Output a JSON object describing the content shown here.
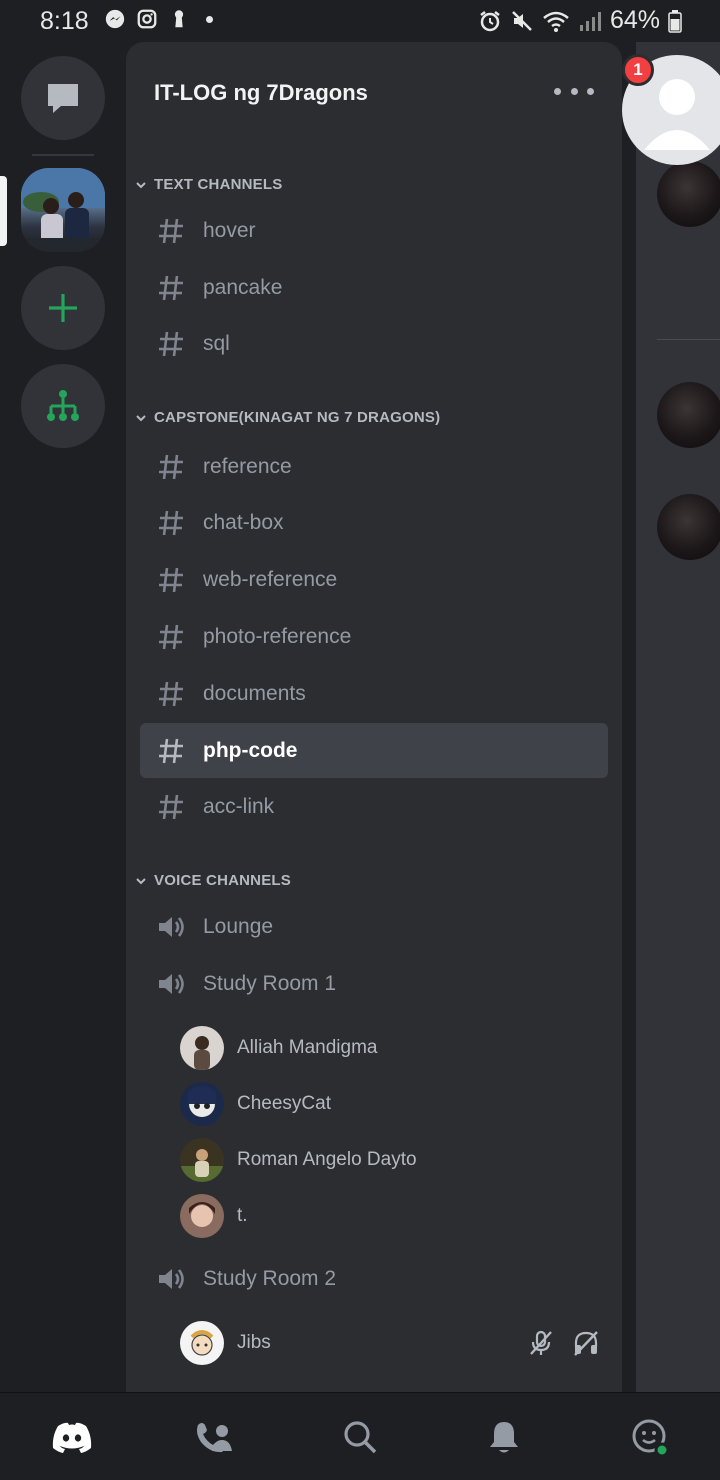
{
  "status_bar": {
    "time": "8:18",
    "battery": "64%"
  },
  "server": {
    "name": "IT-LOG ng 7Dragons"
  },
  "categories": {
    "text": "TEXT CHANNELS",
    "capstone": "CAPSTONE(KINAGAT NG 7 DRAGONS)",
    "voice": "VOICE CHANNELS"
  },
  "text_channels": [
    "hover",
    "pancake",
    "sql"
  ],
  "capstone_channels": [
    "reference",
    "chat-box",
    "web-reference",
    "photo-reference",
    "documents",
    "php-code",
    "acc-link"
  ],
  "active_channel": "php-code",
  "voice_channels": [
    "Lounge",
    "Study Room 1",
    "Study Room 2"
  ],
  "voice_users_room1": [
    "Alliah Mandigma",
    "CheesyCat",
    "Roman Angelo Dayto",
    "t."
  ],
  "voice_users_room2": [
    "Jibs"
  ],
  "notification_count": "1",
  "icons": {
    "dm": "chat-bubble-icon",
    "add_server": "plus-icon",
    "discover": "hierarchy-icon",
    "more": "more-dots-icon",
    "hash": "hash-icon",
    "speaker": "speaker-icon",
    "mute": "mic-muted-icon",
    "deafen": "headphones-muted-icon"
  },
  "bottom_nav": [
    "home-icon",
    "friends-icon",
    "search-icon",
    "bell-icon",
    "profile-icon"
  ],
  "colors": {
    "accent_green": "#23a55a",
    "badge_red": "#f23f42",
    "panel_bg": "#2b2d31",
    "rail_bg": "#1e1f22"
  }
}
